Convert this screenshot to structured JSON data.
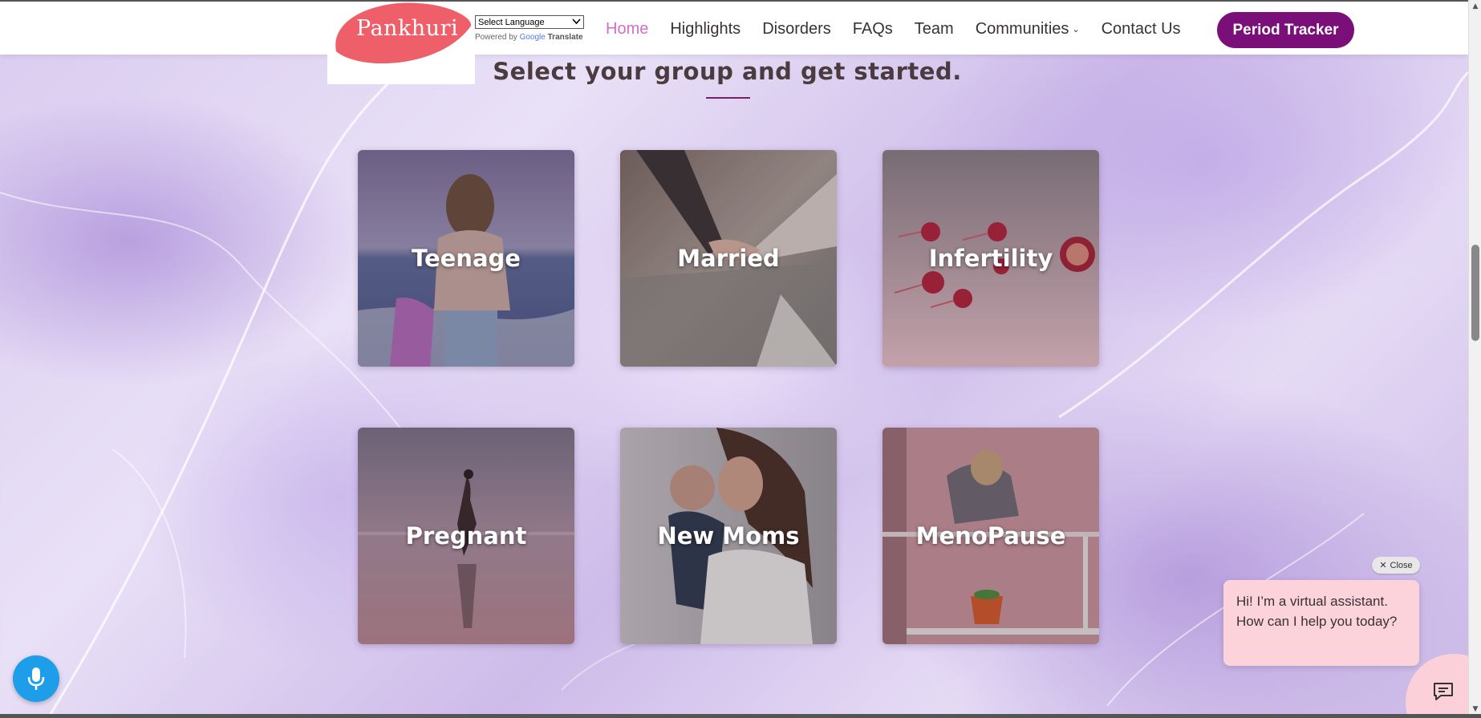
{
  "header": {
    "logo_text": "Pankhuri",
    "translate": {
      "select_label": "Select Language",
      "powered_by": "Powered by",
      "google": "Google",
      "translate_word": "Translate"
    },
    "nav": [
      {
        "label": "Home",
        "active": true
      },
      {
        "label": "Highlights"
      },
      {
        "label": "Disorders"
      },
      {
        "label": "FAQs"
      },
      {
        "label": "Team"
      },
      {
        "label": "Communities"
      },
      {
        "label": "Contact Us"
      }
    ],
    "cta_label": "Period Tracker"
  },
  "section": {
    "title": "Select your group and get started."
  },
  "groups": [
    {
      "label": "Teenage"
    },
    {
      "label": "Married"
    },
    {
      "label": "Infertility"
    },
    {
      "label": "Pregnant"
    },
    {
      "label": "New Moms"
    },
    {
      "label": "MenoPause"
    }
  ],
  "chat": {
    "close_label": "Close",
    "message": "Hi! I’m a virtual assistant. How can I help you today?"
  },
  "icons": {
    "mic": "microphone-icon",
    "chat": "chat-icon",
    "close": "close-icon"
  },
  "colors": {
    "brand_purple": "#7a0f7a",
    "active_nav": "#d36ec9",
    "chat_bubble": "#fcd3da",
    "mic_blue": "#1e9ee8"
  }
}
